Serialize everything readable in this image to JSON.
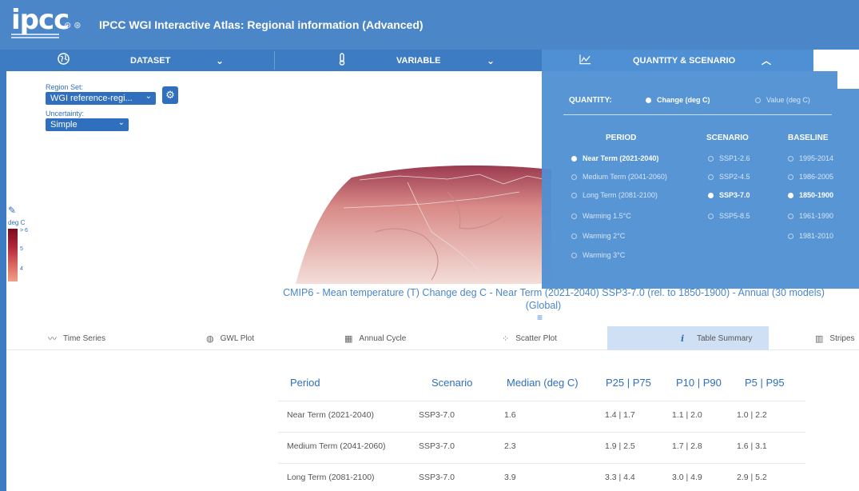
{
  "header": {
    "logo": "ipcc",
    "title": "IPCC WGI Interactive Atlas: Regional information (Advanced)"
  },
  "main_tabs": [
    {
      "label": "DATASET",
      "icon": "globe-icon"
    },
    {
      "label": "VARIABLE",
      "icon": "thermometer-icon"
    },
    {
      "label": "QUANTITY & SCENARIO",
      "icon": "chart-line-icon"
    }
  ],
  "controls": {
    "region_set_label": "Region Set:",
    "region_set_value": "WGI reference-regi...",
    "uncertainty_label": "Uncertainty:",
    "uncertainty_value": "Simple"
  },
  "colorbar": {
    "unit": "deg C",
    "ticks": [
      "> 6",
      "5",
      "4"
    ]
  },
  "caption": {
    "line1": "CMIP6 - Mean temperature (T) Change deg C - Near Term (2021-2040) SSP3-7.0 (rel. to 1850-1900) - Annual (30 models)",
    "line2": "(Global)"
  },
  "bottom_tabs": [
    {
      "label": "Time Series",
      "icon": "timeseries-icon"
    },
    {
      "label": "GWL Plot",
      "icon": "globe-icon"
    },
    {
      "label": "Annual Cycle",
      "icon": "calendar-icon"
    },
    {
      "label": "Scatter Plot",
      "icon": "scatter-icon"
    },
    {
      "label": "Table Summary",
      "icon": "info-icon",
      "active": true
    },
    {
      "label": "Stripes",
      "icon": "stripes-icon"
    }
  ],
  "table": {
    "headers": [
      "Period",
      "Scenario",
      "Median (deg C)",
      "P25 | P75",
      "P10 | P90",
      "P5 | P95"
    ],
    "rows": [
      [
        "Near Term (2021-2040)",
        "SSP3-7.0",
        "1.6",
        "1.4 | 1.7",
        "1.1 | 2.0",
        "1.0 | 2.2"
      ],
      [
        "Medium Term (2041-2060)",
        "SSP3-7.0",
        "2.3",
        "1.9 | 2.5",
        "1.7 | 2.8",
        "1.6 | 3.1"
      ],
      [
        "Long Term (2081-2100)",
        "SSP3-7.0",
        "3.9",
        "3.3 | 4.4",
        "3.0 | 4.9",
        "2.9 | 5.2"
      ]
    ]
  },
  "panel": {
    "quantity_label": "QUANTITY:",
    "quantity_options": [
      {
        "label": "Change (deg C)",
        "selected": true
      },
      {
        "label": "Value (deg C)",
        "selected": false
      }
    ],
    "period_header": "PERIOD",
    "scenario_header": "SCENARIO",
    "baseline_header": "BASELINE",
    "periods": [
      {
        "label": "Near Term (2021-2040)",
        "selected": true
      },
      {
        "label": "Medium Term (2041-2060)",
        "selected": false
      },
      {
        "label": "Long Term (2081-2100)",
        "selected": false
      },
      {
        "label": "Warming 1.5°C",
        "selected": false
      },
      {
        "label": "Warming 2°C",
        "selected": false
      },
      {
        "label": "Warming 3°C",
        "selected": false
      }
    ],
    "scenarios": [
      {
        "label": "SSP1-2.6",
        "selected": false
      },
      {
        "label": "SSP2-4.5",
        "selected": false
      },
      {
        "label": "SSP3-7.0",
        "selected": true
      },
      {
        "label": "SSP5-8.5",
        "selected": false
      }
    ],
    "baselines": [
      {
        "label": "1995-2014",
        "selected": false
      },
      {
        "label": "1986-2005",
        "selected": false
      },
      {
        "label": "1850-1900",
        "selected": true
      },
      {
        "label": "1961-1990",
        "selected": false
      },
      {
        "label": "1981-2010",
        "selected": false
      }
    ]
  },
  "colors": {
    "header_blue": "#4a86c8",
    "accent_blue": "#2f6fbd",
    "panel_blue": "#4f8fd3",
    "heat_dark": "#7a0b1e",
    "heat_light": "#efa089"
  }
}
